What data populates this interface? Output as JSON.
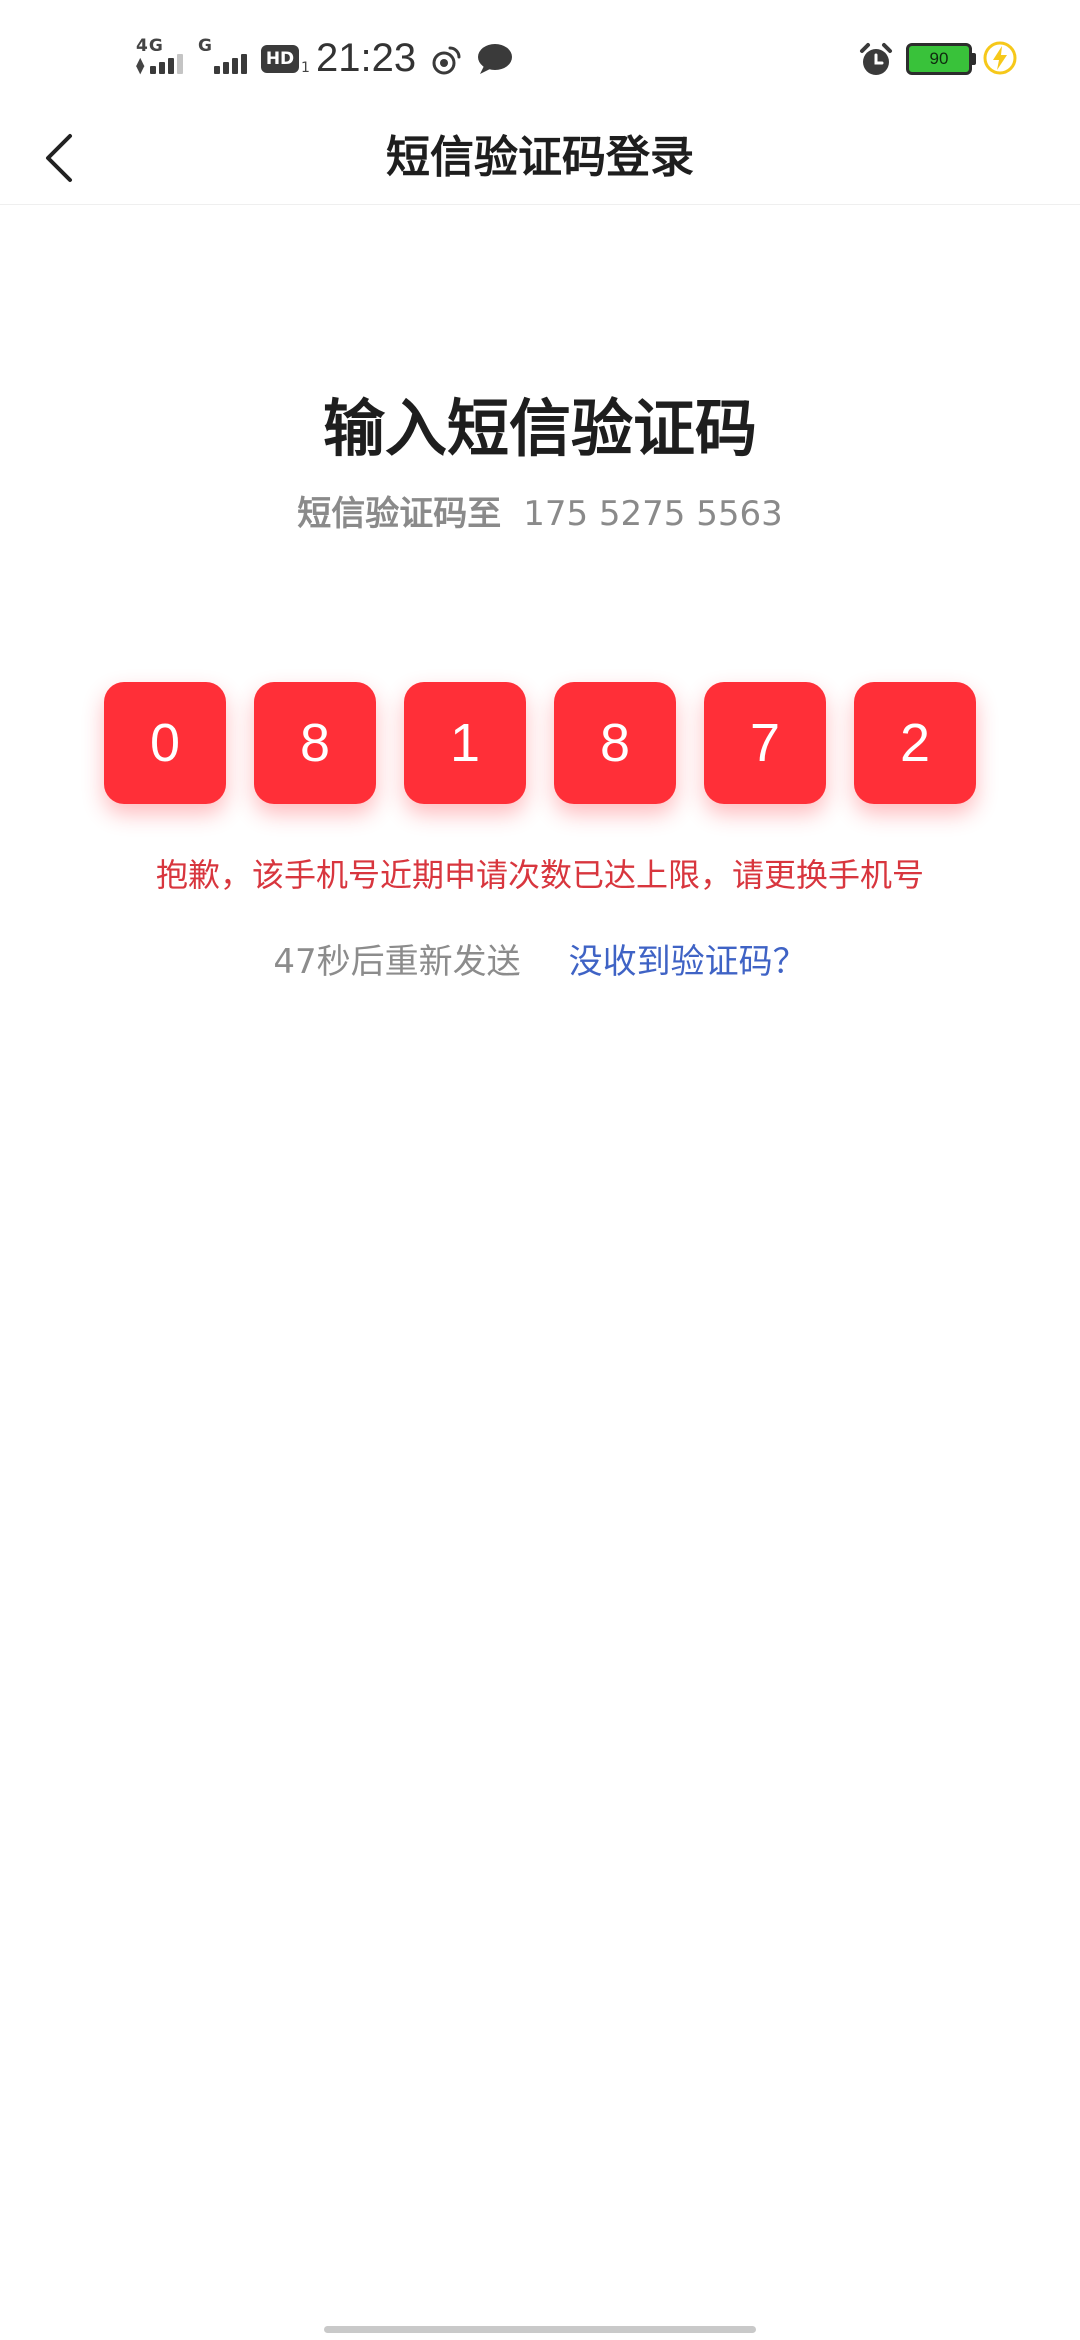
{
  "status_bar": {
    "sim1_network": "4G",
    "sim2_network": "G",
    "hd_badge": "HD",
    "hd_sub": "1",
    "time": "21:23",
    "battery_level": "90",
    "battery_color": "#39c23a",
    "icons": [
      "weibo-icon",
      "message-bubble-icon",
      "alarm-icon",
      "battery-icon",
      "charging-icon"
    ]
  },
  "nav": {
    "title": "短信验证码登录",
    "back_icon": "chevron-left-icon"
  },
  "main": {
    "title": "输入短信验证码",
    "subtitle_label": "短信验证码至",
    "phone_number": "175 5275 5563",
    "code_digits": [
      "0",
      "8",
      "1",
      "8",
      "7",
      "2"
    ],
    "code_box_color": "#ff2f38",
    "error_message": "抱歉，该手机号近期申请次数已达上限，请更换手机号",
    "error_color": "#d8363e",
    "resend_countdown": "47秒后重新发送",
    "no_code_link": "没收到验证码？",
    "link_color": "#3f63c5"
  }
}
